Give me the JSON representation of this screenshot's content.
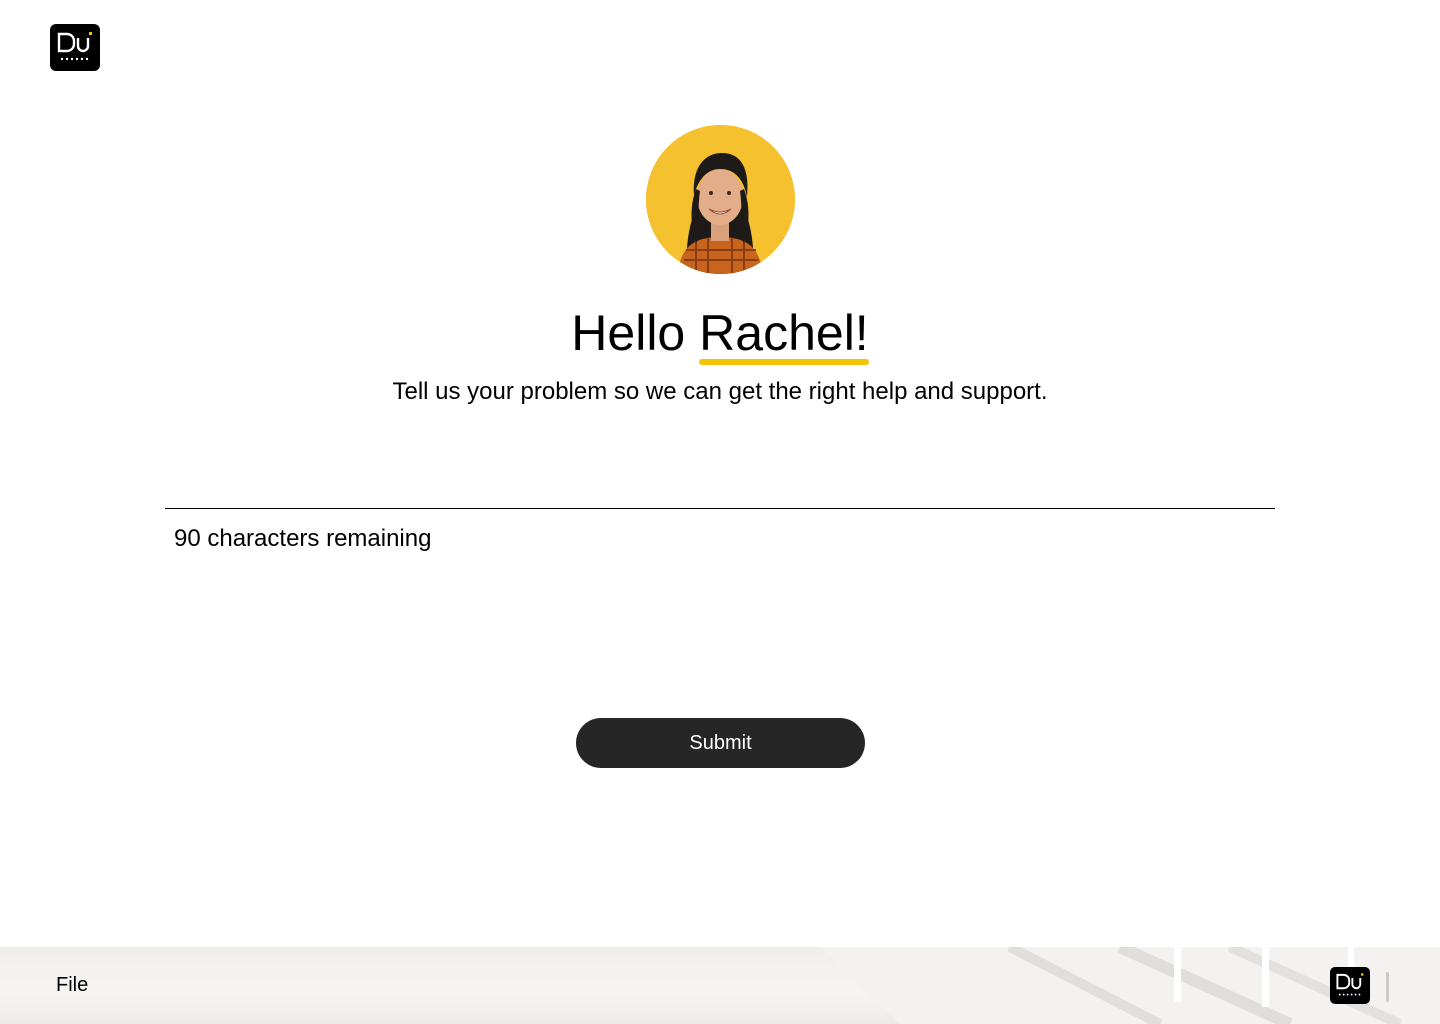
{
  "header": {
    "logo_icon": "dg-logo-icon"
  },
  "profile": {
    "avatar_icon": "user-avatar"
  },
  "greeting": {
    "prefix": "Hello",
    "name": "Rachel!"
  },
  "subtitle": "Tell us your problem so we can get the right help and support.",
  "problem_input": {
    "value": "",
    "placeholder": ""
  },
  "char_count": "90 characters remaining",
  "submit_label": "Submit",
  "footer": {
    "file_label": "File",
    "logo_icon": "dg-logo-icon"
  },
  "colors": {
    "accent": "#f5c400",
    "button_bg": "#262626",
    "avatar_bg": "#f6c12e"
  }
}
